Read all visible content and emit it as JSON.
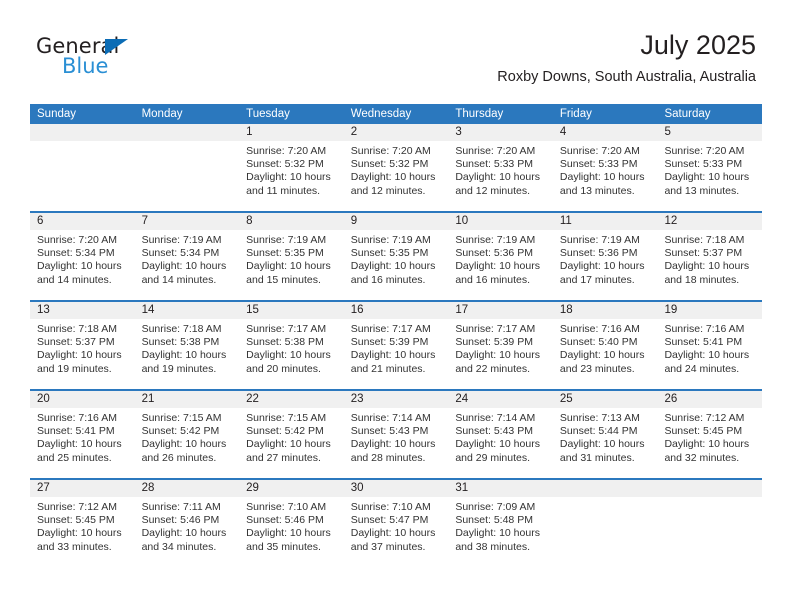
{
  "brand": {
    "name_part1": "General",
    "name_part2": "Blue",
    "triangle_color": "#0b6cb5",
    "blue_text_color": "#2a8fd4"
  },
  "header": {
    "title": "July 2025",
    "subtitle": "Roxby Downs, South Australia, Australia"
  },
  "theme": {
    "header_blue": "#2b78be",
    "daynum_band": "#f0f0f0",
    "text": "#231f20"
  },
  "weekdays": [
    "Sunday",
    "Monday",
    "Tuesday",
    "Wednesday",
    "Thursday",
    "Friday",
    "Saturday"
  ],
  "labels": {
    "sunrise_prefix": "Sunrise:",
    "sunset_prefix": "Sunset:",
    "daylight_prefix": "Daylight:"
  },
  "weeks": [
    {
      "days": [
        {
          "num": "",
          "sunrise": "",
          "sunset": "",
          "daylight_line1": "",
          "daylight_line2": ""
        },
        {
          "num": "",
          "sunrise": "",
          "sunset": "",
          "daylight_line1": "",
          "daylight_line2": ""
        },
        {
          "num": "1",
          "sunrise": "Sunrise: 7:20 AM",
          "sunset": "Sunset: 5:32 PM",
          "daylight_line1": "Daylight: 10 hours",
          "daylight_line2": "and 11 minutes."
        },
        {
          "num": "2",
          "sunrise": "Sunrise: 7:20 AM",
          "sunset": "Sunset: 5:32 PM",
          "daylight_line1": "Daylight: 10 hours",
          "daylight_line2": "and 12 minutes."
        },
        {
          "num": "3",
          "sunrise": "Sunrise: 7:20 AM",
          "sunset": "Sunset: 5:33 PM",
          "daylight_line1": "Daylight: 10 hours",
          "daylight_line2": "and 12 minutes."
        },
        {
          "num": "4",
          "sunrise": "Sunrise: 7:20 AM",
          "sunset": "Sunset: 5:33 PM",
          "daylight_line1": "Daylight: 10 hours",
          "daylight_line2": "and 13 minutes."
        },
        {
          "num": "5",
          "sunrise": "Sunrise: 7:20 AM",
          "sunset": "Sunset: 5:33 PM",
          "daylight_line1": "Daylight: 10 hours",
          "daylight_line2": "and 13 minutes."
        }
      ]
    },
    {
      "days": [
        {
          "num": "6",
          "sunrise": "Sunrise: 7:20 AM",
          "sunset": "Sunset: 5:34 PM",
          "daylight_line1": "Daylight: 10 hours",
          "daylight_line2": "and 14 minutes."
        },
        {
          "num": "7",
          "sunrise": "Sunrise: 7:19 AM",
          "sunset": "Sunset: 5:34 PM",
          "daylight_line1": "Daylight: 10 hours",
          "daylight_line2": "and 14 minutes."
        },
        {
          "num": "8",
          "sunrise": "Sunrise: 7:19 AM",
          "sunset": "Sunset: 5:35 PM",
          "daylight_line1": "Daylight: 10 hours",
          "daylight_line2": "and 15 minutes."
        },
        {
          "num": "9",
          "sunrise": "Sunrise: 7:19 AM",
          "sunset": "Sunset: 5:35 PM",
          "daylight_line1": "Daylight: 10 hours",
          "daylight_line2": "and 16 minutes."
        },
        {
          "num": "10",
          "sunrise": "Sunrise: 7:19 AM",
          "sunset": "Sunset: 5:36 PM",
          "daylight_line1": "Daylight: 10 hours",
          "daylight_line2": "and 16 minutes."
        },
        {
          "num": "11",
          "sunrise": "Sunrise: 7:19 AM",
          "sunset": "Sunset: 5:36 PM",
          "daylight_line1": "Daylight: 10 hours",
          "daylight_line2": "and 17 minutes."
        },
        {
          "num": "12",
          "sunrise": "Sunrise: 7:18 AM",
          "sunset": "Sunset: 5:37 PM",
          "daylight_line1": "Daylight: 10 hours",
          "daylight_line2": "and 18 minutes."
        }
      ]
    },
    {
      "days": [
        {
          "num": "13",
          "sunrise": "Sunrise: 7:18 AM",
          "sunset": "Sunset: 5:37 PM",
          "daylight_line1": "Daylight: 10 hours",
          "daylight_line2": "and 19 minutes."
        },
        {
          "num": "14",
          "sunrise": "Sunrise: 7:18 AM",
          "sunset": "Sunset: 5:38 PM",
          "daylight_line1": "Daylight: 10 hours",
          "daylight_line2": "and 19 minutes."
        },
        {
          "num": "15",
          "sunrise": "Sunrise: 7:17 AM",
          "sunset": "Sunset: 5:38 PM",
          "daylight_line1": "Daylight: 10 hours",
          "daylight_line2": "and 20 minutes."
        },
        {
          "num": "16",
          "sunrise": "Sunrise: 7:17 AM",
          "sunset": "Sunset: 5:39 PM",
          "daylight_line1": "Daylight: 10 hours",
          "daylight_line2": "and 21 minutes."
        },
        {
          "num": "17",
          "sunrise": "Sunrise: 7:17 AM",
          "sunset": "Sunset: 5:39 PM",
          "daylight_line1": "Daylight: 10 hours",
          "daylight_line2": "and 22 minutes."
        },
        {
          "num": "18",
          "sunrise": "Sunrise: 7:16 AM",
          "sunset": "Sunset: 5:40 PM",
          "daylight_line1": "Daylight: 10 hours",
          "daylight_line2": "and 23 minutes."
        },
        {
          "num": "19",
          "sunrise": "Sunrise: 7:16 AM",
          "sunset": "Sunset: 5:41 PM",
          "daylight_line1": "Daylight: 10 hours",
          "daylight_line2": "and 24 minutes."
        }
      ]
    },
    {
      "days": [
        {
          "num": "20",
          "sunrise": "Sunrise: 7:16 AM",
          "sunset": "Sunset: 5:41 PM",
          "daylight_line1": "Daylight: 10 hours",
          "daylight_line2": "and 25 minutes."
        },
        {
          "num": "21",
          "sunrise": "Sunrise: 7:15 AM",
          "sunset": "Sunset: 5:42 PM",
          "daylight_line1": "Daylight: 10 hours",
          "daylight_line2": "and 26 minutes."
        },
        {
          "num": "22",
          "sunrise": "Sunrise: 7:15 AM",
          "sunset": "Sunset: 5:42 PM",
          "daylight_line1": "Daylight: 10 hours",
          "daylight_line2": "and 27 minutes."
        },
        {
          "num": "23",
          "sunrise": "Sunrise: 7:14 AM",
          "sunset": "Sunset: 5:43 PM",
          "daylight_line1": "Daylight: 10 hours",
          "daylight_line2": "and 28 minutes."
        },
        {
          "num": "24",
          "sunrise": "Sunrise: 7:14 AM",
          "sunset": "Sunset: 5:43 PM",
          "daylight_line1": "Daylight: 10 hours",
          "daylight_line2": "and 29 minutes."
        },
        {
          "num": "25",
          "sunrise": "Sunrise: 7:13 AM",
          "sunset": "Sunset: 5:44 PM",
          "daylight_line1": "Daylight: 10 hours",
          "daylight_line2": "and 31 minutes."
        },
        {
          "num": "26",
          "sunrise": "Sunrise: 7:12 AM",
          "sunset": "Sunset: 5:45 PM",
          "daylight_line1": "Daylight: 10 hours",
          "daylight_line2": "and 32 minutes."
        }
      ]
    },
    {
      "days": [
        {
          "num": "27",
          "sunrise": "Sunrise: 7:12 AM",
          "sunset": "Sunset: 5:45 PM",
          "daylight_line1": "Daylight: 10 hours",
          "daylight_line2": "and 33 minutes."
        },
        {
          "num": "28",
          "sunrise": "Sunrise: 7:11 AM",
          "sunset": "Sunset: 5:46 PM",
          "daylight_line1": "Daylight: 10 hours",
          "daylight_line2": "and 34 minutes."
        },
        {
          "num": "29",
          "sunrise": "Sunrise: 7:10 AM",
          "sunset": "Sunset: 5:46 PM",
          "daylight_line1": "Daylight: 10 hours",
          "daylight_line2": "and 35 minutes."
        },
        {
          "num": "30",
          "sunrise": "Sunrise: 7:10 AM",
          "sunset": "Sunset: 5:47 PM",
          "daylight_line1": "Daylight: 10 hours",
          "daylight_line2": "and 37 minutes."
        },
        {
          "num": "31",
          "sunrise": "Sunrise: 7:09 AM",
          "sunset": "Sunset: 5:48 PM",
          "daylight_line1": "Daylight: 10 hours",
          "daylight_line2": "and 38 minutes."
        },
        {
          "num": "",
          "sunrise": "",
          "sunset": "",
          "daylight_line1": "",
          "daylight_line2": ""
        },
        {
          "num": "",
          "sunrise": "",
          "sunset": "",
          "daylight_line1": "",
          "daylight_line2": ""
        }
      ]
    }
  ]
}
